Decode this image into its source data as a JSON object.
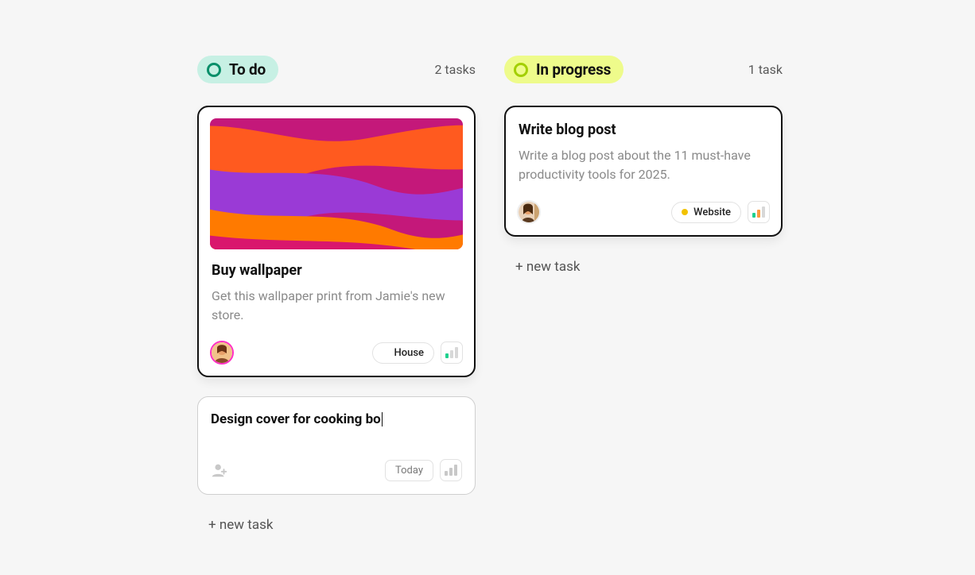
{
  "columns": {
    "todo": {
      "label": "To do",
      "count": "2 tasks",
      "new_task": "+ new task"
    },
    "inprogress": {
      "label": "In progress",
      "count": "1 task",
      "new_task": "+ new task"
    }
  },
  "cards": {
    "wallpaper": {
      "title": "Buy wallpaper",
      "desc": "Get this wallpaper print from Jamie's new store.",
      "tag_label": "House",
      "tag_color": "#ff2ec4"
    },
    "cooking": {
      "title_partial": "Design cover for cooking bo",
      "date": "Today"
    },
    "blog": {
      "title": "Write blog post",
      "desc": "Write a blog post about the 11 must-have productivity tools for 2025.",
      "tag_label": "Website",
      "tag_color": "#f2c200"
    }
  },
  "priority_colors": {
    "low": {
      "b1": "#1fd18e",
      "b2": "#d8d8d8",
      "b3": "#d8d8d8"
    },
    "med": {
      "b1": "#1fd18e",
      "b2": "#ff9a3c",
      "b3": "#d8d8d8"
    },
    "none": {
      "b1": "#c8c8c8",
      "b2": "#c8c8c8",
      "b3": "#c8c8c8"
    }
  }
}
